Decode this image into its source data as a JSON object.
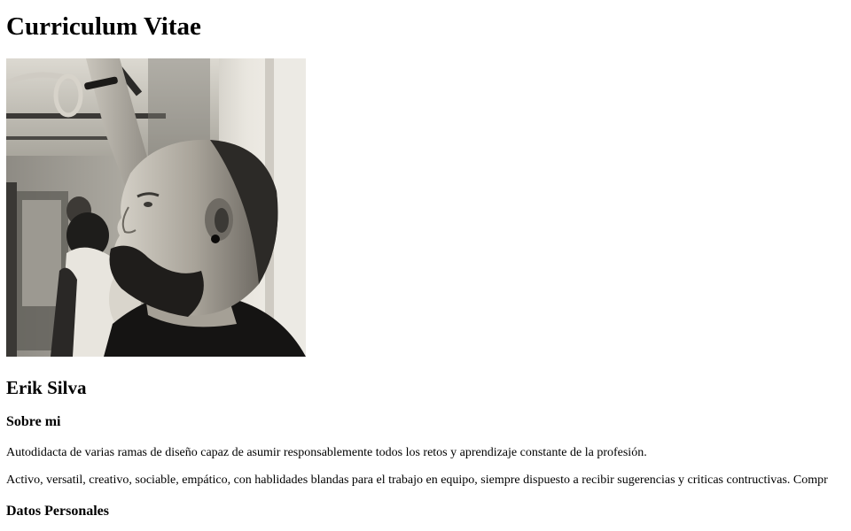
{
  "page": {
    "title": "Curriculum Vitae",
    "name": "Erik Silva",
    "about": {
      "heading": "Sobre mi",
      "paragraphs": [
        "Autodidacta de varias ramas de diseño capaz de asumir responsablemente todos los retos y aprendizaje constante de la profesión.",
        "Activo, versatil, creativo, sociable, empático, con hablidades blandas para el trabajo en equipo, siempre dispuesto a recibir sugerencias y criticas contructivas. Compr"
      ]
    },
    "personal": {
      "heading": "Datos Personales"
    }
  },
  "photo": {
    "subject": "black-and-white portrait photo of a bearded man on a subway train",
    "palette": [
      "#f2f0ea",
      "#b9b6ad",
      "#6e6b65",
      "#2a2826",
      "#0f0e0d"
    ]
  }
}
